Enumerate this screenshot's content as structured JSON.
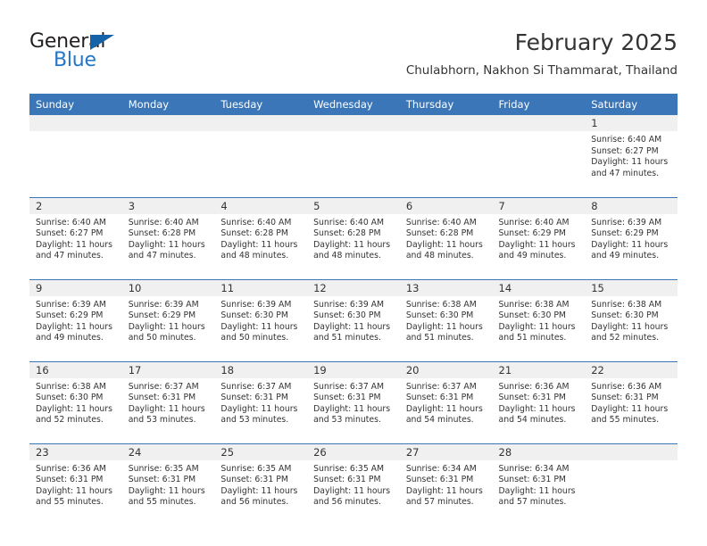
{
  "brand": {
    "name_primary": "General",
    "name_secondary": "Blue",
    "accent_color": "#1463a8",
    "secondary_color": "#2277c8",
    "triangle_icon": "triangle-icon"
  },
  "header": {
    "title": "February 2025",
    "subtitle": "Chulabhorn, Nakhon Si Thammarat, Thailand"
  },
  "theme": {
    "header_row_bg": "#3a76b8",
    "daynum_bg": "#f0f0f0",
    "text_color": "#333333",
    "grid_line": "#3a76b8"
  },
  "weekdays": [
    "Sunday",
    "Monday",
    "Tuesday",
    "Wednesday",
    "Thursday",
    "Friday",
    "Saturday"
  ],
  "weeks": [
    [
      {
        "day": "",
        "empty": true
      },
      {
        "day": "",
        "empty": true
      },
      {
        "day": "",
        "empty": true
      },
      {
        "day": "",
        "empty": true
      },
      {
        "day": "",
        "empty": true
      },
      {
        "day": "",
        "empty": true
      },
      {
        "day": "1",
        "sunrise": "Sunrise: 6:40 AM",
        "sunset": "Sunset: 6:27 PM",
        "daylight1": "Daylight: 11 hours",
        "daylight2": "and 47 minutes."
      }
    ],
    [
      {
        "day": "2",
        "sunrise": "Sunrise: 6:40 AM",
        "sunset": "Sunset: 6:27 PM",
        "daylight1": "Daylight: 11 hours",
        "daylight2": "and 47 minutes."
      },
      {
        "day": "3",
        "sunrise": "Sunrise: 6:40 AM",
        "sunset": "Sunset: 6:28 PM",
        "daylight1": "Daylight: 11 hours",
        "daylight2": "and 47 minutes."
      },
      {
        "day": "4",
        "sunrise": "Sunrise: 6:40 AM",
        "sunset": "Sunset: 6:28 PM",
        "daylight1": "Daylight: 11 hours",
        "daylight2": "and 48 minutes."
      },
      {
        "day": "5",
        "sunrise": "Sunrise: 6:40 AM",
        "sunset": "Sunset: 6:28 PM",
        "daylight1": "Daylight: 11 hours",
        "daylight2": "and 48 minutes."
      },
      {
        "day": "6",
        "sunrise": "Sunrise: 6:40 AM",
        "sunset": "Sunset: 6:28 PM",
        "daylight1": "Daylight: 11 hours",
        "daylight2": "and 48 minutes."
      },
      {
        "day": "7",
        "sunrise": "Sunrise: 6:40 AM",
        "sunset": "Sunset: 6:29 PM",
        "daylight1": "Daylight: 11 hours",
        "daylight2": "and 49 minutes."
      },
      {
        "day": "8",
        "sunrise": "Sunrise: 6:39 AM",
        "sunset": "Sunset: 6:29 PM",
        "daylight1": "Daylight: 11 hours",
        "daylight2": "and 49 minutes."
      }
    ],
    [
      {
        "day": "9",
        "sunrise": "Sunrise: 6:39 AM",
        "sunset": "Sunset: 6:29 PM",
        "daylight1": "Daylight: 11 hours",
        "daylight2": "and 49 minutes."
      },
      {
        "day": "10",
        "sunrise": "Sunrise: 6:39 AM",
        "sunset": "Sunset: 6:29 PM",
        "daylight1": "Daylight: 11 hours",
        "daylight2": "and 50 minutes."
      },
      {
        "day": "11",
        "sunrise": "Sunrise: 6:39 AM",
        "sunset": "Sunset: 6:30 PM",
        "daylight1": "Daylight: 11 hours",
        "daylight2": "and 50 minutes."
      },
      {
        "day": "12",
        "sunrise": "Sunrise: 6:39 AM",
        "sunset": "Sunset: 6:30 PM",
        "daylight1": "Daylight: 11 hours",
        "daylight2": "and 51 minutes."
      },
      {
        "day": "13",
        "sunrise": "Sunrise: 6:38 AM",
        "sunset": "Sunset: 6:30 PM",
        "daylight1": "Daylight: 11 hours",
        "daylight2": "and 51 minutes."
      },
      {
        "day": "14",
        "sunrise": "Sunrise: 6:38 AM",
        "sunset": "Sunset: 6:30 PM",
        "daylight1": "Daylight: 11 hours",
        "daylight2": "and 51 minutes."
      },
      {
        "day": "15",
        "sunrise": "Sunrise: 6:38 AM",
        "sunset": "Sunset: 6:30 PM",
        "daylight1": "Daylight: 11 hours",
        "daylight2": "and 52 minutes."
      }
    ],
    [
      {
        "day": "16",
        "sunrise": "Sunrise: 6:38 AM",
        "sunset": "Sunset: 6:30 PM",
        "daylight1": "Daylight: 11 hours",
        "daylight2": "and 52 minutes."
      },
      {
        "day": "17",
        "sunrise": "Sunrise: 6:37 AM",
        "sunset": "Sunset: 6:31 PM",
        "daylight1": "Daylight: 11 hours",
        "daylight2": "and 53 minutes."
      },
      {
        "day": "18",
        "sunrise": "Sunrise: 6:37 AM",
        "sunset": "Sunset: 6:31 PM",
        "daylight1": "Daylight: 11 hours",
        "daylight2": "and 53 minutes."
      },
      {
        "day": "19",
        "sunrise": "Sunrise: 6:37 AM",
        "sunset": "Sunset: 6:31 PM",
        "daylight1": "Daylight: 11 hours",
        "daylight2": "and 53 minutes."
      },
      {
        "day": "20",
        "sunrise": "Sunrise: 6:37 AM",
        "sunset": "Sunset: 6:31 PM",
        "daylight1": "Daylight: 11 hours",
        "daylight2": "and 54 minutes."
      },
      {
        "day": "21",
        "sunrise": "Sunrise: 6:36 AM",
        "sunset": "Sunset: 6:31 PM",
        "daylight1": "Daylight: 11 hours",
        "daylight2": "and 54 minutes."
      },
      {
        "day": "22",
        "sunrise": "Sunrise: 6:36 AM",
        "sunset": "Sunset: 6:31 PM",
        "daylight1": "Daylight: 11 hours",
        "daylight2": "and 55 minutes."
      }
    ],
    [
      {
        "day": "23",
        "sunrise": "Sunrise: 6:36 AM",
        "sunset": "Sunset: 6:31 PM",
        "daylight1": "Daylight: 11 hours",
        "daylight2": "and 55 minutes."
      },
      {
        "day": "24",
        "sunrise": "Sunrise: 6:35 AM",
        "sunset": "Sunset: 6:31 PM",
        "daylight1": "Daylight: 11 hours",
        "daylight2": "and 55 minutes."
      },
      {
        "day": "25",
        "sunrise": "Sunrise: 6:35 AM",
        "sunset": "Sunset: 6:31 PM",
        "daylight1": "Daylight: 11 hours",
        "daylight2": "and 56 minutes."
      },
      {
        "day": "26",
        "sunrise": "Sunrise: 6:35 AM",
        "sunset": "Sunset: 6:31 PM",
        "daylight1": "Daylight: 11 hours",
        "daylight2": "and 56 minutes."
      },
      {
        "day": "27",
        "sunrise": "Sunrise: 6:34 AM",
        "sunset": "Sunset: 6:31 PM",
        "daylight1": "Daylight: 11 hours",
        "daylight2": "and 57 minutes."
      },
      {
        "day": "28",
        "sunrise": "Sunrise: 6:34 AM",
        "sunset": "Sunset: 6:31 PM",
        "daylight1": "Daylight: 11 hours",
        "daylight2": "and 57 minutes."
      },
      {
        "day": "",
        "empty": true
      }
    ]
  ]
}
